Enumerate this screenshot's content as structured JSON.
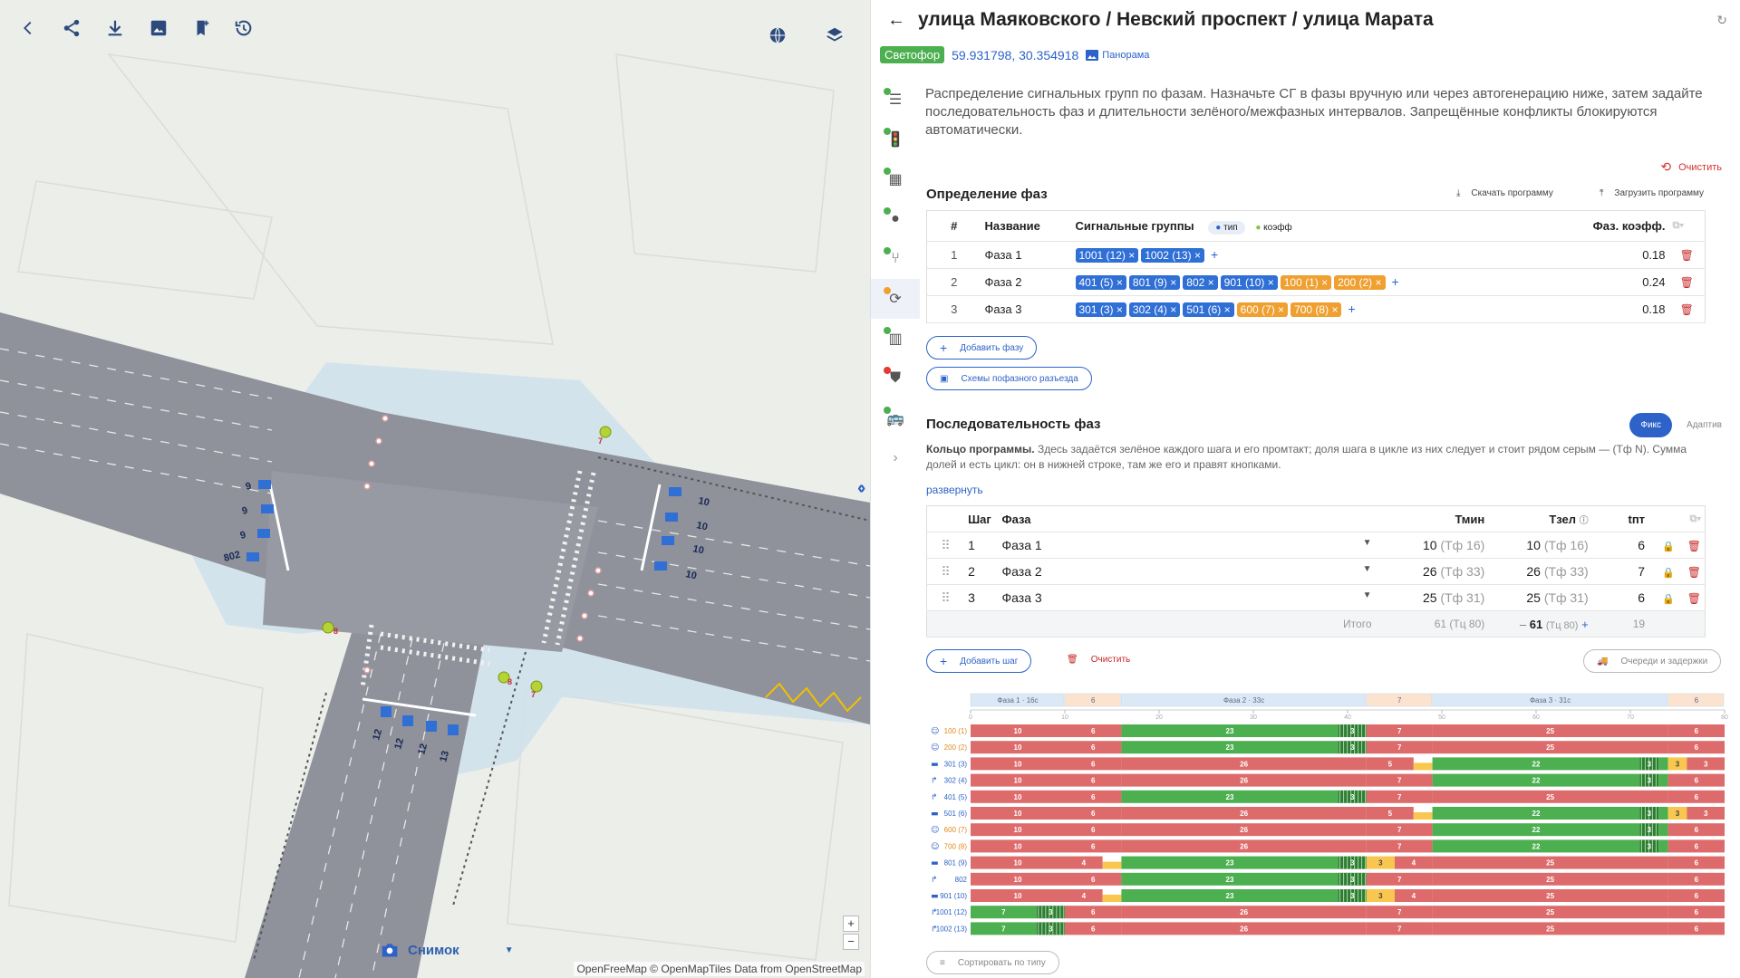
{
  "map": {
    "snapshot_label": "Снимок",
    "attribution": "OpenFreeMap © OpenMapTiles Data from OpenStreetMap",
    "zoom_in": "+",
    "zoom_out": "−",
    "signal_labels": [
      {
        "t": "9"
      },
      {
        "t": "9"
      },
      {
        "t": "9"
      },
      {
        "t": "802"
      },
      {
        "t": "10"
      },
      {
        "t": "10"
      },
      {
        "t": "10"
      },
      {
        "t": "10"
      },
      {
        "t": "12"
      },
      {
        "t": "12"
      },
      {
        "t": "12"
      },
      {
        "t": "13"
      }
    ],
    "ped_labels": [
      "7",
      "8",
      "8",
      "7"
    ]
  },
  "header": {
    "title": "улица Маяковского / Невский проспект / улица Марата",
    "badge": "Светофор",
    "coords": "59.931798, 30.354918",
    "panorama": "Панорама"
  },
  "description": "Распределение сигнальных групп по фазам. Назначьте СГ в фазы вручную или через автогенерацию ниже, затем задайте последовательность фаз и длительности зелёного/межфазных интервалов. Запрещённые конфликты блокируются автоматически.",
  "clear_label": "Очистить",
  "phases_section": {
    "title": "Определение фаз",
    "download": "Скачать программу",
    "upload": "Загрузить программу",
    "col_num": "#",
    "col_name": "Название",
    "col_groups": "Сигнальные группы",
    "legend_type": "тип",
    "legend_coef": "коэфф",
    "col_coef": "Фаз. коэфф.",
    "rows": [
      {
        "num": "1",
        "name": "Фаза 1",
        "groups": [
          {
            "t": "1001 (12)",
            "c": "blue"
          },
          {
            "t": "1002 (13)",
            "c": "blue"
          }
        ],
        "coef": "0.18"
      },
      {
        "num": "2",
        "name": "Фаза 2",
        "groups": [
          {
            "t": "401 (5)",
            "c": "blue"
          },
          {
            "t": "801 (9)",
            "c": "blue"
          },
          {
            "t": "802",
            "c": "blue"
          },
          {
            "t": "901 (10)",
            "c": "blue"
          },
          {
            "t": "100 (1)",
            "c": "orange"
          },
          {
            "t": "200 (2)",
            "c": "orange"
          }
        ],
        "coef": "0.24"
      },
      {
        "num": "3",
        "name": "Фаза 3",
        "groups": [
          {
            "t": "301 (3)",
            "c": "blue"
          },
          {
            "t": "302 (4)",
            "c": "blue"
          },
          {
            "t": "501 (6)",
            "c": "blue"
          },
          {
            "t": "600 (7)",
            "c": "orange"
          },
          {
            "t": "700 (8)",
            "c": "orange"
          }
        ],
        "coef": "0.18"
      }
    ],
    "add_phase": "Добавить фазу",
    "schemes": "Схемы пофазного разъезда"
  },
  "sequence_section": {
    "title": "Последовательность фаз",
    "mode_fixed": "Фикс",
    "mode_adaptive": "Адаптив",
    "ring_bold": "Кольцо программы.",
    "ring_text": "Здесь задаётся зелёное каждого шага и его промтакт; доля шага в цикле из них следует и стоит рядом серым — (Тф N). Сумма долей и есть цикл: он в нижней строке, там же его и правят кнопками.",
    "expand": "развернуть",
    "col_step": "Шаг",
    "col_phase": "Фаза",
    "col_tmin": "Тмин",
    "col_tzel": "Тзел",
    "col_tpt": "tпт",
    "rows": [
      {
        "step": "1",
        "phase": "Фаза 1",
        "tmin": "10",
        "tmin_tf": "(Тф 16)",
        "tzel": "10",
        "tzel_tf": "(Тф 16)",
        "tpt": "6"
      },
      {
        "step": "2",
        "phase": "Фаза 2",
        "tmin": "26",
        "tmin_tf": "(Тф 33)",
        "tzel": "26",
        "tzel_tf": "(Тф 33)",
        "tpt": "7"
      },
      {
        "step": "3",
        "phase": "Фаза 3",
        "tmin": "25",
        "tmin_tf": "(Тф 31)",
        "tzel": "25",
        "tzel_tf": "(Тф 31)",
        "tpt": "6"
      }
    ],
    "total_label": "Итого",
    "total_tmin": "61 (Тц 80)",
    "total_tzel": "61",
    "total_tzel_tc": "(Тц 80)",
    "total_tpt": "19",
    "add_step": "Добавить шаг",
    "clear": "Очистить",
    "queues": "Очереди и задержки",
    "sort": "Сортировать по типу"
  },
  "diagram": {
    "axis_ticks": [
      0,
      10,
      20,
      30,
      40,
      50,
      60,
      70,
      80
    ],
    "cycle": 80,
    "phase_bars": [
      {
        "label": "Фаза 1 · 16с",
        "start": 0,
        "end": 10,
        "kind": "phase"
      },
      {
        "label": "6",
        "start": 10,
        "end": 16,
        "kind": "inter"
      },
      {
        "label": "Фаза 2 · 33с",
        "start": 16,
        "end": 42,
        "kind": "phase"
      },
      {
        "label": "7",
        "start": 42,
        "end": 49,
        "kind": "inter"
      },
      {
        "label": "Фаза 3 · 31с",
        "start": 49,
        "end": 74,
        "kind": "phase"
      },
      {
        "label": "6",
        "start": 74,
        "end": 80,
        "kind": "inter"
      }
    ],
    "rows": [
      {
        "name": "100 (1)",
        "icon": "ped",
        "segs": [
          [
            0,
            10,
            "R",
            "10"
          ],
          [
            10,
            16,
            "R",
            "6"
          ],
          [
            16,
            39,
            "G",
            "23"
          ],
          [
            39,
            42,
            "F",
            "3"
          ],
          [
            42,
            49,
            "R",
            "7"
          ],
          [
            49,
            74,
            "R",
            "25"
          ],
          [
            74,
            80,
            "R",
            "6"
          ]
        ]
      },
      {
        "name": "200 (2)",
        "icon": "ped",
        "segs": [
          [
            0,
            10,
            "R",
            "10"
          ],
          [
            10,
            16,
            "R",
            "6"
          ],
          [
            16,
            39,
            "G",
            "23"
          ],
          [
            39,
            42,
            "F",
            "3"
          ],
          [
            42,
            49,
            "R",
            "7"
          ],
          [
            49,
            74,
            "R",
            "25"
          ],
          [
            74,
            80,
            "R",
            "6"
          ]
        ]
      },
      {
        "name": "301 (3)",
        "icon": "car",
        "segs": [
          [
            0,
            10,
            "R",
            "10"
          ],
          [
            10,
            16,
            "R",
            "6"
          ],
          [
            16,
            42,
            "R",
            "26"
          ],
          [
            42,
            47,
            "R",
            "5"
          ],
          [
            47,
            49,
            "Y",
            ""
          ],
          [
            49,
            71,
            "G",
            "22"
          ],
          [
            71,
            73,
            "F",
            "3"
          ],
          [
            73,
            74,
            "G",
            ""
          ],
          [
            74,
            76,
            "Y",
            "3"
          ],
          [
            76,
            80,
            "R",
            "3"
          ]
        ]
      },
      {
        "name": "302 (4)",
        "icon": "turn",
        "segs": [
          [
            0,
            10,
            "R",
            "10"
          ],
          [
            10,
            16,
            "R",
            "6"
          ],
          [
            16,
            42,
            "R",
            "26"
          ],
          [
            42,
            49,
            "R",
            "7"
          ],
          [
            49,
            71,
            "G",
            "22"
          ],
          [
            71,
            73,
            "F",
            "3"
          ],
          [
            73,
            74,
            "G",
            ""
          ],
          [
            74,
            80,
            "R",
            "6"
          ]
        ]
      },
      {
        "name": "401 (5)",
        "icon": "turn",
        "segs": [
          [
            0,
            10,
            "R",
            "10"
          ],
          [
            10,
            16,
            "R",
            "6"
          ],
          [
            16,
            39,
            "G",
            "23"
          ],
          [
            39,
            42,
            "F",
            "3"
          ],
          [
            42,
            49,
            "R",
            "7"
          ],
          [
            49,
            74,
            "R",
            "25"
          ],
          [
            74,
            80,
            "R",
            "6"
          ]
        ]
      },
      {
        "name": "501 (6)",
        "icon": "car",
        "segs": [
          [
            0,
            10,
            "R",
            "10"
          ],
          [
            10,
            16,
            "R",
            "6"
          ],
          [
            16,
            42,
            "R",
            "26"
          ],
          [
            42,
            47,
            "R",
            "5"
          ],
          [
            47,
            49,
            "Y",
            ""
          ],
          [
            49,
            71,
            "G",
            "22"
          ],
          [
            71,
            73,
            "F",
            "3"
          ],
          [
            73,
            74,
            "G",
            ""
          ],
          [
            74,
            76,
            "Y",
            "3"
          ],
          [
            76,
            80,
            "R",
            "3"
          ]
        ]
      },
      {
        "name": "600 (7)",
        "icon": "ped",
        "segs": [
          [
            0,
            10,
            "R",
            "10"
          ],
          [
            10,
            16,
            "R",
            "6"
          ],
          [
            16,
            42,
            "R",
            "26"
          ],
          [
            42,
            49,
            "R",
            "7"
          ],
          [
            49,
            71,
            "G",
            "22"
          ],
          [
            71,
            73,
            "F",
            "3"
          ],
          [
            73,
            74,
            "G",
            ""
          ],
          [
            74,
            80,
            "R",
            "6"
          ]
        ]
      },
      {
        "name": "700 (8)",
        "icon": "ped",
        "segs": [
          [
            0,
            10,
            "R",
            "10"
          ],
          [
            10,
            16,
            "R",
            "6"
          ],
          [
            16,
            42,
            "R",
            "26"
          ],
          [
            42,
            49,
            "R",
            "7"
          ],
          [
            49,
            71,
            "G",
            "22"
          ],
          [
            71,
            73,
            "F",
            "3"
          ],
          [
            73,
            74,
            "G",
            ""
          ],
          [
            74,
            80,
            "R",
            "6"
          ]
        ]
      },
      {
        "name": "801 (9)",
        "icon": "car",
        "segs": [
          [
            0,
            10,
            "R",
            "10"
          ],
          [
            10,
            14,
            "R",
            "4"
          ],
          [
            14,
            16,
            "Y",
            ""
          ],
          [
            16,
            39,
            "G",
            "23"
          ],
          [
            39,
            42,
            "F",
            "3"
          ],
          [
            42,
            45,
            "Y",
            "3"
          ],
          [
            45,
            49,
            "R",
            "4"
          ],
          [
            49,
            74,
            "R",
            "25"
          ],
          [
            74,
            80,
            "R",
            "6"
          ]
        ]
      },
      {
        "name": "802",
        "icon": "turn",
        "segs": [
          [
            0,
            10,
            "R",
            "10"
          ],
          [
            10,
            16,
            "R",
            "6"
          ],
          [
            16,
            39,
            "G",
            "23"
          ],
          [
            39,
            42,
            "F",
            "3"
          ],
          [
            42,
            49,
            "R",
            "7"
          ],
          [
            49,
            74,
            "R",
            "25"
          ],
          [
            74,
            80,
            "R",
            "6"
          ]
        ]
      },
      {
        "name": "901 (10)",
        "icon": "car",
        "segs": [
          [
            0,
            10,
            "R",
            "10"
          ],
          [
            10,
            14,
            "R",
            "4"
          ],
          [
            14,
            16,
            "Y",
            ""
          ],
          [
            16,
            39,
            "G",
            "23"
          ],
          [
            39,
            42,
            "F",
            "3"
          ],
          [
            42,
            45,
            "Y",
            "3"
          ],
          [
            45,
            49,
            "R",
            "4"
          ],
          [
            49,
            74,
            "R",
            "25"
          ],
          [
            74,
            80,
            "R",
            "6"
          ]
        ]
      },
      {
        "name": "1001 (12)",
        "icon": "turn",
        "segs": [
          [
            0,
            7,
            "G",
            "7"
          ],
          [
            7,
            10,
            "F",
            "3"
          ],
          [
            10,
            16,
            "R",
            "6"
          ],
          [
            16,
            42,
            "R",
            "26"
          ],
          [
            42,
            49,
            "R",
            "7"
          ],
          [
            49,
            74,
            "R",
            "25"
          ],
          [
            74,
            80,
            "R",
            "6"
          ]
        ]
      },
      {
        "name": "1002 (13)",
        "icon": "turn",
        "segs": [
          [
            0,
            7,
            "G",
            "7"
          ],
          [
            7,
            10,
            "F",
            "3"
          ],
          [
            10,
            16,
            "R",
            "6"
          ],
          [
            16,
            42,
            "R",
            "26"
          ],
          [
            42,
            49,
            "R",
            "7"
          ],
          [
            49,
            74,
            "R",
            "25"
          ],
          [
            74,
            80,
            "R",
            "6"
          ]
        ]
      }
    ],
    "colors": {
      "R": "#dd6b6b",
      "G": "#4caf50",
      "F": "#2e7d32",
      "Y": "#f9c74f",
      "phase": "#dbe9f7",
      "inter": "#fbe3cf"
    }
  }
}
